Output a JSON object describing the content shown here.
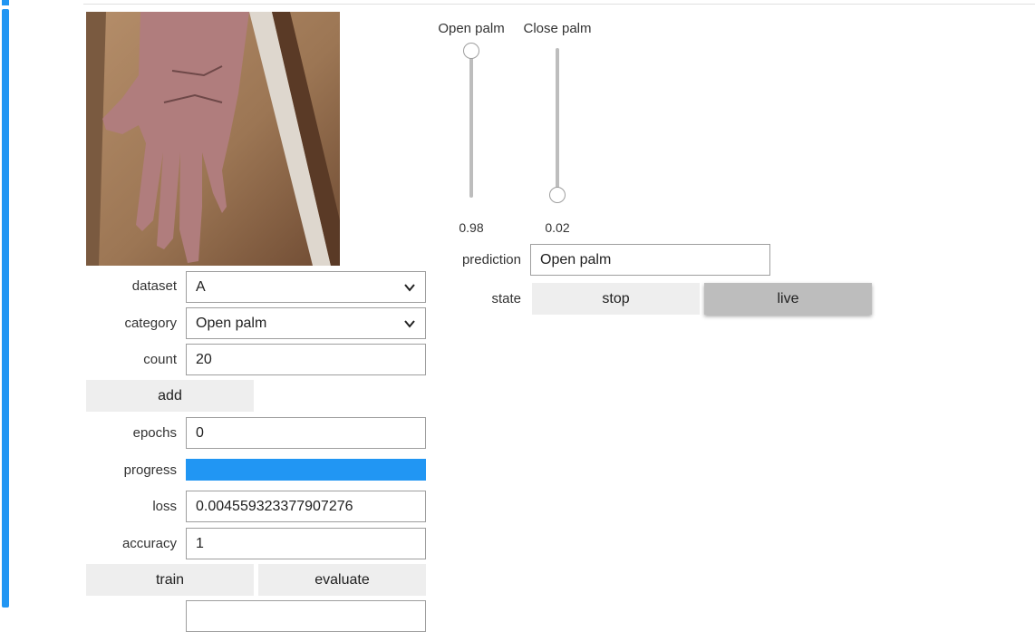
{
  "camera": {
    "label": "hand-image"
  },
  "form": {
    "dataset_label": "dataset",
    "dataset_value": "A",
    "category_label": "category",
    "category_value": "Open palm",
    "count_label": "count",
    "count_value": "20",
    "add_label": "add",
    "epochs_label": "epochs",
    "epochs_value": "0",
    "progress_label": "progress",
    "progress_fraction": 1.0,
    "loss_label": "loss",
    "loss_value": "0.004559323377907276",
    "accuracy_label": "accuracy",
    "accuracy_value": "1",
    "train_label": "train",
    "evaluate_label": "evaluate"
  },
  "sliders": [
    {
      "label": "Open palm",
      "value_text": "0.98",
      "value": 0.98
    },
    {
      "label": "Close palm",
      "value_text": "0.02",
      "value": 0.02
    }
  ],
  "prediction": {
    "label": "prediction",
    "value": "Open palm"
  },
  "state": {
    "label": "state",
    "stop_label": "stop",
    "live_label": "live",
    "active": "live"
  },
  "colors": {
    "accent": "#2196f3",
    "button_bg": "#eeeeee",
    "button_active_bg": "#bdbdbd"
  }
}
